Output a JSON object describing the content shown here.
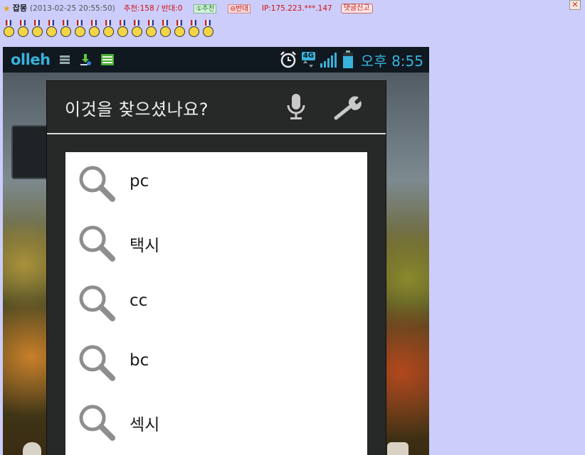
{
  "comment": {
    "author": "잡몽",
    "date": "(2013-02-25 20:55:50)",
    "votes": "추천:158 / 반대:0",
    "upvote_label": "①추천",
    "downvote_label": "⊖반대",
    "ip": "IP:175.223.***.147",
    "report_label": "댓글신고",
    "close_label": "✕",
    "medal_count": 15
  },
  "phone": {
    "carrier": "olleh",
    "network_badge": "4G",
    "clock": "오후 8:55",
    "dialog_title": "이것을 찾으셨나요?",
    "suggestions": [
      "pc",
      "택시",
      "cc",
      "bc",
      "섹시"
    ]
  },
  "colors": {
    "page_bg": "#cccdfb",
    "status_text": "#39b2da",
    "dialog_bg": "#272828",
    "vote_red": "#d01010"
  }
}
